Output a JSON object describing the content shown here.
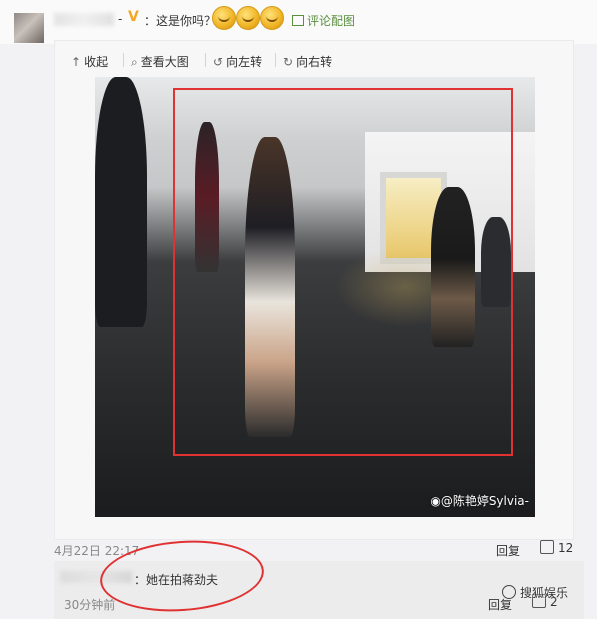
{
  "comment": {
    "v_badge": "V",
    "text": "：这是你吗？",
    "pic_link": "评论配图"
  },
  "toolbar": {
    "collapse": "收起",
    "view_large": "查看大图",
    "rotate_left": "向左转",
    "rotate_right": "向右转"
  },
  "photo": {
    "watermark": "@陈艳婷Sylvia-"
  },
  "meta": {
    "timestamp": "4月22日 22:17",
    "reply": "回复",
    "likes": "12"
  },
  "subreply": {
    "text": "：她在拍蒋劲夫",
    "time": "30分钟前",
    "reply": "回复",
    "likes": "2"
  },
  "brand": {
    "label": "搜狐娱乐"
  },
  "colors": {
    "highlight": "#e03232",
    "pic_link": "#5a8f3e",
    "v_badge": "#f5a623"
  },
  "icons": [
    "arrow-up-icon",
    "magnifier-icon",
    "rotate-left-icon",
    "rotate-right-icon",
    "image-icon",
    "thumb-up-icon",
    "weibo-icon",
    "laugh-emoji-icon"
  ]
}
